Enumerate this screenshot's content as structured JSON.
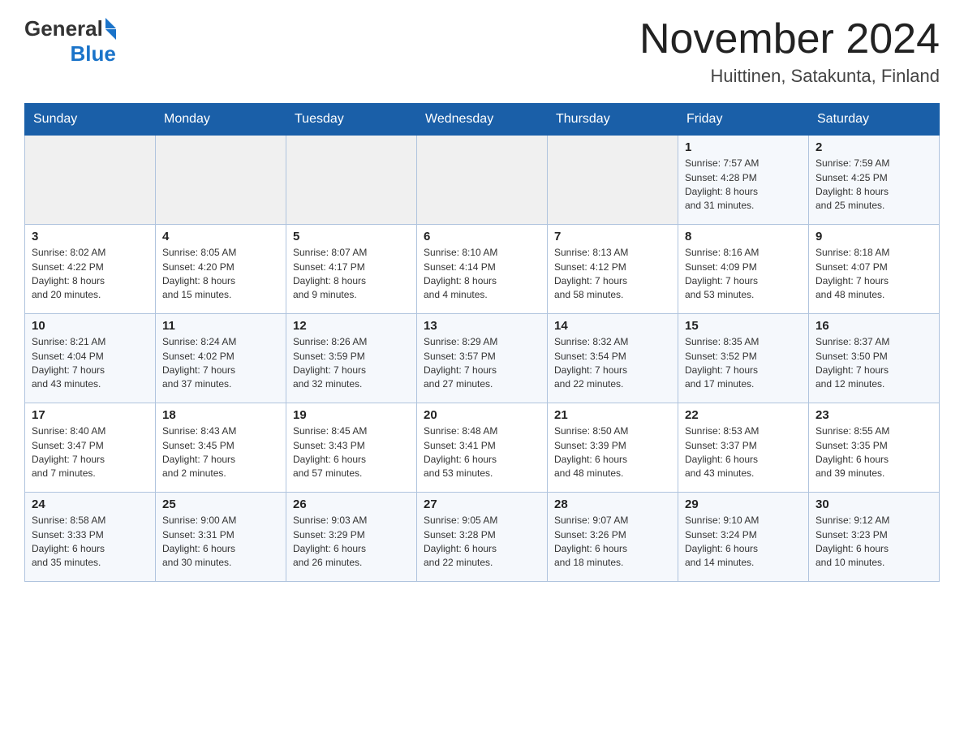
{
  "header": {
    "logo_general": "General",
    "logo_blue": "Blue",
    "month_title": "November 2024",
    "location": "Huittinen, Satakunta, Finland"
  },
  "weekdays": [
    "Sunday",
    "Monday",
    "Tuesday",
    "Wednesday",
    "Thursday",
    "Friday",
    "Saturday"
  ],
  "weeks": [
    [
      {
        "day": "",
        "info": ""
      },
      {
        "day": "",
        "info": ""
      },
      {
        "day": "",
        "info": ""
      },
      {
        "day": "",
        "info": ""
      },
      {
        "day": "",
        "info": ""
      },
      {
        "day": "1",
        "info": "Sunrise: 7:57 AM\nSunset: 4:28 PM\nDaylight: 8 hours\nand 31 minutes."
      },
      {
        "day": "2",
        "info": "Sunrise: 7:59 AM\nSunset: 4:25 PM\nDaylight: 8 hours\nand 25 minutes."
      }
    ],
    [
      {
        "day": "3",
        "info": "Sunrise: 8:02 AM\nSunset: 4:22 PM\nDaylight: 8 hours\nand 20 minutes."
      },
      {
        "day": "4",
        "info": "Sunrise: 8:05 AM\nSunset: 4:20 PM\nDaylight: 8 hours\nand 15 minutes."
      },
      {
        "day": "5",
        "info": "Sunrise: 8:07 AM\nSunset: 4:17 PM\nDaylight: 8 hours\nand 9 minutes."
      },
      {
        "day": "6",
        "info": "Sunrise: 8:10 AM\nSunset: 4:14 PM\nDaylight: 8 hours\nand 4 minutes."
      },
      {
        "day": "7",
        "info": "Sunrise: 8:13 AM\nSunset: 4:12 PM\nDaylight: 7 hours\nand 58 minutes."
      },
      {
        "day": "8",
        "info": "Sunrise: 8:16 AM\nSunset: 4:09 PM\nDaylight: 7 hours\nand 53 minutes."
      },
      {
        "day": "9",
        "info": "Sunrise: 8:18 AM\nSunset: 4:07 PM\nDaylight: 7 hours\nand 48 minutes."
      }
    ],
    [
      {
        "day": "10",
        "info": "Sunrise: 8:21 AM\nSunset: 4:04 PM\nDaylight: 7 hours\nand 43 minutes."
      },
      {
        "day": "11",
        "info": "Sunrise: 8:24 AM\nSunset: 4:02 PM\nDaylight: 7 hours\nand 37 minutes."
      },
      {
        "day": "12",
        "info": "Sunrise: 8:26 AM\nSunset: 3:59 PM\nDaylight: 7 hours\nand 32 minutes."
      },
      {
        "day": "13",
        "info": "Sunrise: 8:29 AM\nSunset: 3:57 PM\nDaylight: 7 hours\nand 27 minutes."
      },
      {
        "day": "14",
        "info": "Sunrise: 8:32 AM\nSunset: 3:54 PM\nDaylight: 7 hours\nand 22 minutes."
      },
      {
        "day": "15",
        "info": "Sunrise: 8:35 AM\nSunset: 3:52 PM\nDaylight: 7 hours\nand 17 minutes."
      },
      {
        "day": "16",
        "info": "Sunrise: 8:37 AM\nSunset: 3:50 PM\nDaylight: 7 hours\nand 12 minutes."
      }
    ],
    [
      {
        "day": "17",
        "info": "Sunrise: 8:40 AM\nSunset: 3:47 PM\nDaylight: 7 hours\nand 7 minutes."
      },
      {
        "day": "18",
        "info": "Sunrise: 8:43 AM\nSunset: 3:45 PM\nDaylight: 7 hours\nand 2 minutes."
      },
      {
        "day": "19",
        "info": "Sunrise: 8:45 AM\nSunset: 3:43 PM\nDaylight: 6 hours\nand 57 minutes."
      },
      {
        "day": "20",
        "info": "Sunrise: 8:48 AM\nSunset: 3:41 PM\nDaylight: 6 hours\nand 53 minutes."
      },
      {
        "day": "21",
        "info": "Sunrise: 8:50 AM\nSunset: 3:39 PM\nDaylight: 6 hours\nand 48 minutes."
      },
      {
        "day": "22",
        "info": "Sunrise: 8:53 AM\nSunset: 3:37 PM\nDaylight: 6 hours\nand 43 minutes."
      },
      {
        "day": "23",
        "info": "Sunrise: 8:55 AM\nSunset: 3:35 PM\nDaylight: 6 hours\nand 39 minutes."
      }
    ],
    [
      {
        "day": "24",
        "info": "Sunrise: 8:58 AM\nSunset: 3:33 PM\nDaylight: 6 hours\nand 35 minutes."
      },
      {
        "day": "25",
        "info": "Sunrise: 9:00 AM\nSunset: 3:31 PM\nDaylight: 6 hours\nand 30 minutes."
      },
      {
        "day": "26",
        "info": "Sunrise: 9:03 AM\nSunset: 3:29 PM\nDaylight: 6 hours\nand 26 minutes."
      },
      {
        "day": "27",
        "info": "Sunrise: 9:05 AM\nSunset: 3:28 PM\nDaylight: 6 hours\nand 22 minutes."
      },
      {
        "day": "28",
        "info": "Sunrise: 9:07 AM\nSunset: 3:26 PM\nDaylight: 6 hours\nand 18 minutes."
      },
      {
        "day": "29",
        "info": "Sunrise: 9:10 AM\nSunset: 3:24 PM\nDaylight: 6 hours\nand 14 minutes."
      },
      {
        "day": "30",
        "info": "Sunrise: 9:12 AM\nSunset: 3:23 PM\nDaylight: 6 hours\nand 10 minutes."
      }
    ]
  ]
}
